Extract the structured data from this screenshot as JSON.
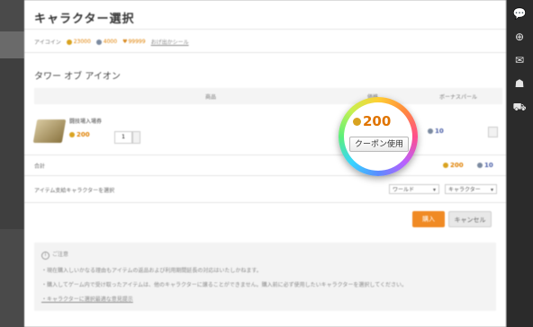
{
  "page": {
    "title": "キャラクター選択",
    "meta": {
      "label": "アイコイン",
      "gold": "23000",
      "gem": "4000",
      "hearts": "99999",
      "link": "おげ出かシール"
    },
    "game_title": "タワー オブ アイオン",
    "table": {
      "headers": [
        "商品",
        "価格",
        "ボーナスパール"
      ],
      "item": {
        "name": "闘技場入場券",
        "price": "200",
        "qty": "1",
        "bonus": "10"
      }
    },
    "total": {
      "label": "合計",
      "gold": "200",
      "gem": "10"
    },
    "select_row": {
      "label": "アイテム支給キャラクターを選択",
      "server": "ワールド",
      "character": "キャラクター"
    },
    "buttons": {
      "ok": "購入",
      "cancel": "キャンセル"
    },
    "notice": {
      "title": "ご注意",
      "lines": [
        "・現在購入しいかなる理由もアイテムの返品および利用期間延長の対応はいたしかねます。",
        "・購入してゲーム内で受け取ったアイテムは、他のキャラクターに譲ることができません。購入前に必ず使用したいキャラクターを選択してください。",
        "・キャラクターに選択最適な意見提示"
      ]
    },
    "magnifier": {
      "price": "200",
      "coupon": "クーポン使用"
    }
  },
  "colors": {
    "accent": "#f08a24",
    "gold_text": "#e08000",
    "gem_text": "#4a5ea8"
  },
  "right_bar_icons": [
    "chat-icon",
    "plus-icon",
    "message-icon",
    "friends-icon",
    "cart-icon"
  ]
}
